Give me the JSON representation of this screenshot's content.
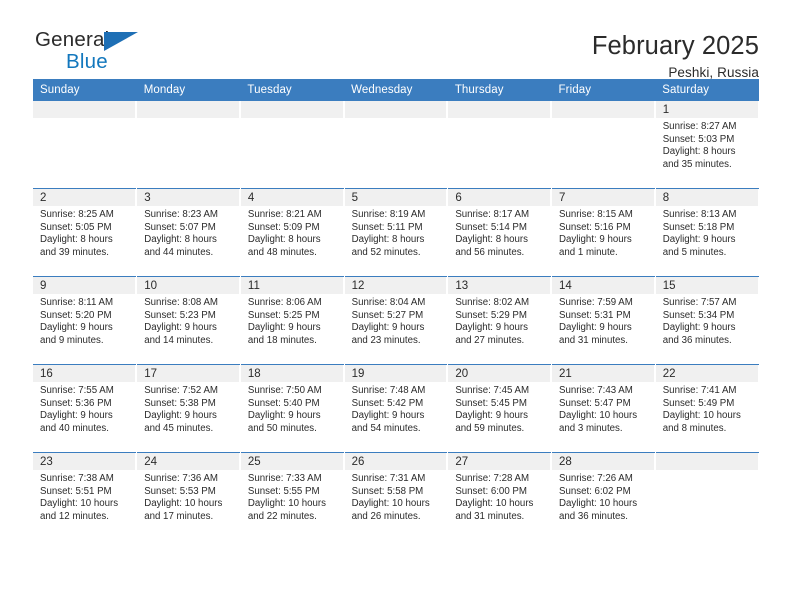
{
  "logo": {
    "word1": "General",
    "word2": "Blue",
    "triangle_color": "#1e6fb5",
    "word2_color": "#1277bd"
  },
  "header": {
    "title": "February 2025",
    "subtitle": "Peshki, Russia"
  },
  "theme": {
    "header_blue": "#3b7dbf",
    "daynum_band": "#f0f0f0",
    "text": "#2b2b2b"
  },
  "weekday_headers": [
    "Sunday",
    "Monday",
    "Tuesday",
    "Wednesday",
    "Thursday",
    "Friday",
    "Saturday"
  ],
  "labels": {
    "sunrise_prefix": "Sunrise:",
    "sunset_prefix": "Sunset:",
    "daylight_prefix": "Daylight:"
  },
  "weeks": [
    [
      {
        "day": "",
        "line1": "",
        "line2": "",
        "line3": "",
        "line4": "",
        "empty": true
      },
      {
        "day": "",
        "line1": "",
        "line2": "",
        "line3": "",
        "line4": "",
        "empty": true
      },
      {
        "day": "",
        "line1": "",
        "line2": "",
        "line3": "",
        "line4": "",
        "empty": true
      },
      {
        "day": "",
        "line1": "",
        "line2": "",
        "line3": "",
        "line4": "",
        "empty": true
      },
      {
        "day": "",
        "line1": "",
        "line2": "",
        "line3": "",
        "line4": "",
        "empty": true
      },
      {
        "day": "",
        "line1": "",
        "line2": "",
        "line3": "",
        "line4": "",
        "empty": true
      },
      {
        "day": "1",
        "line1": "Sunrise: 8:27 AM",
        "line2": "Sunset: 5:03 PM",
        "line3": "Daylight: 8 hours",
        "line4": "and 35 minutes.",
        "empty": false
      }
    ],
    [
      {
        "day": "2",
        "line1": "Sunrise: 8:25 AM",
        "line2": "Sunset: 5:05 PM",
        "line3": "Daylight: 8 hours",
        "line4": "and 39 minutes.",
        "empty": false
      },
      {
        "day": "3",
        "line1": "Sunrise: 8:23 AM",
        "line2": "Sunset: 5:07 PM",
        "line3": "Daylight: 8 hours",
        "line4": "and 44 minutes.",
        "empty": false
      },
      {
        "day": "4",
        "line1": "Sunrise: 8:21 AM",
        "line2": "Sunset: 5:09 PM",
        "line3": "Daylight: 8 hours",
        "line4": "and 48 minutes.",
        "empty": false
      },
      {
        "day": "5",
        "line1": "Sunrise: 8:19 AM",
        "line2": "Sunset: 5:11 PM",
        "line3": "Daylight: 8 hours",
        "line4": "and 52 minutes.",
        "empty": false
      },
      {
        "day": "6",
        "line1": "Sunrise: 8:17 AM",
        "line2": "Sunset: 5:14 PM",
        "line3": "Daylight: 8 hours",
        "line4": "and 56 minutes.",
        "empty": false
      },
      {
        "day": "7",
        "line1": "Sunrise: 8:15 AM",
        "line2": "Sunset: 5:16 PM",
        "line3": "Daylight: 9 hours",
        "line4": "and 1 minute.",
        "empty": false
      },
      {
        "day": "8",
        "line1": "Sunrise: 8:13 AM",
        "line2": "Sunset: 5:18 PM",
        "line3": "Daylight: 9 hours",
        "line4": "and 5 minutes.",
        "empty": false
      }
    ],
    [
      {
        "day": "9",
        "line1": "Sunrise: 8:11 AM",
        "line2": "Sunset: 5:20 PM",
        "line3": "Daylight: 9 hours",
        "line4": "and 9 minutes.",
        "empty": false
      },
      {
        "day": "10",
        "line1": "Sunrise: 8:08 AM",
        "line2": "Sunset: 5:23 PM",
        "line3": "Daylight: 9 hours",
        "line4": "and 14 minutes.",
        "empty": false
      },
      {
        "day": "11",
        "line1": "Sunrise: 8:06 AM",
        "line2": "Sunset: 5:25 PM",
        "line3": "Daylight: 9 hours",
        "line4": "and 18 minutes.",
        "empty": false
      },
      {
        "day": "12",
        "line1": "Sunrise: 8:04 AM",
        "line2": "Sunset: 5:27 PM",
        "line3": "Daylight: 9 hours",
        "line4": "and 23 minutes.",
        "empty": false
      },
      {
        "day": "13",
        "line1": "Sunrise: 8:02 AM",
        "line2": "Sunset: 5:29 PM",
        "line3": "Daylight: 9 hours",
        "line4": "and 27 minutes.",
        "empty": false
      },
      {
        "day": "14",
        "line1": "Sunrise: 7:59 AM",
        "line2": "Sunset: 5:31 PM",
        "line3": "Daylight: 9 hours",
        "line4": "and 31 minutes.",
        "empty": false
      },
      {
        "day": "15",
        "line1": "Sunrise: 7:57 AM",
        "line2": "Sunset: 5:34 PM",
        "line3": "Daylight: 9 hours",
        "line4": "and 36 minutes.",
        "empty": false
      }
    ],
    [
      {
        "day": "16",
        "line1": "Sunrise: 7:55 AM",
        "line2": "Sunset: 5:36 PM",
        "line3": "Daylight: 9 hours",
        "line4": "and 40 minutes.",
        "empty": false
      },
      {
        "day": "17",
        "line1": "Sunrise: 7:52 AM",
        "line2": "Sunset: 5:38 PM",
        "line3": "Daylight: 9 hours",
        "line4": "and 45 minutes.",
        "empty": false
      },
      {
        "day": "18",
        "line1": "Sunrise: 7:50 AM",
        "line2": "Sunset: 5:40 PM",
        "line3": "Daylight: 9 hours",
        "line4": "and 50 minutes.",
        "empty": false
      },
      {
        "day": "19",
        "line1": "Sunrise: 7:48 AM",
        "line2": "Sunset: 5:42 PM",
        "line3": "Daylight: 9 hours",
        "line4": "and 54 minutes.",
        "empty": false
      },
      {
        "day": "20",
        "line1": "Sunrise: 7:45 AM",
        "line2": "Sunset: 5:45 PM",
        "line3": "Daylight: 9 hours",
        "line4": "and 59 minutes.",
        "empty": false
      },
      {
        "day": "21",
        "line1": "Sunrise: 7:43 AM",
        "line2": "Sunset: 5:47 PM",
        "line3": "Daylight: 10 hours",
        "line4": "and 3 minutes.",
        "empty": false
      },
      {
        "day": "22",
        "line1": "Sunrise: 7:41 AM",
        "line2": "Sunset: 5:49 PM",
        "line3": "Daylight: 10 hours",
        "line4": "and 8 minutes.",
        "empty": false
      }
    ],
    [
      {
        "day": "23",
        "line1": "Sunrise: 7:38 AM",
        "line2": "Sunset: 5:51 PM",
        "line3": "Daylight: 10 hours",
        "line4": "and 12 minutes.",
        "empty": false
      },
      {
        "day": "24",
        "line1": "Sunrise: 7:36 AM",
        "line2": "Sunset: 5:53 PM",
        "line3": "Daylight: 10 hours",
        "line4": "and 17 minutes.",
        "empty": false
      },
      {
        "day": "25",
        "line1": "Sunrise: 7:33 AM",
        "line2": "Sunset: 5:55 PM",
        "line3": "Daylight: 10 hours",
        "line4": "and 22 minutes.",
        "empty": false
      },
      {
        "day": "26",
        "line1": "Sunrise: 7:31 AM",
        "line2": "Sunset: 5:58 PM",
        "line3": "Daylight: 10 hours",
        "line4": "and 26 minutes.",
        "empty": false
      },
      {
        "day": "27",
        "line1": "Sunrise: 7:28 AM",
        "line2": "Sunset: 6:00 PM",
        "line3": "Daylight: 10 hours",
        "line4": "and 31 minutes.",
        "empty": false
      },
      {
        "day": "28",
        "line1": "Sunrise: 7:26 AM",
        "line2": "Sunset: 6:02 PM",
        "line3": "Daylight: 10 hours",
        "line4": "and 36 minutes.",
        "empty": false
      },
      {
        "day": "",
        "line1": "",
        "line2": "",
        "line3": "",
        "line4": "",
        "empty": true
      }
    ]
  ]
}
